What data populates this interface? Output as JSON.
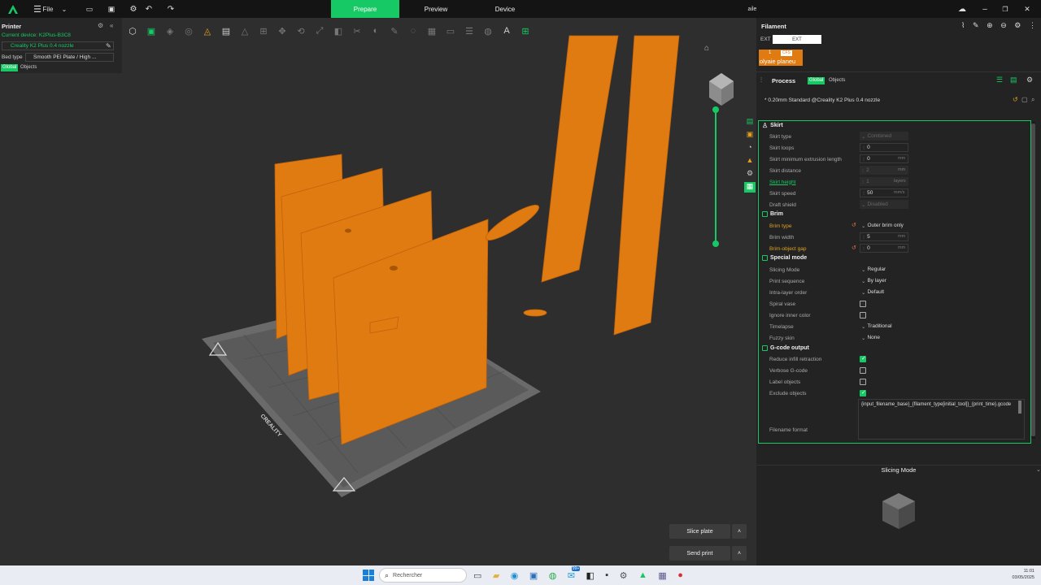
{
  "topbar": {
    "file_label": "File",
    "tabs": [
      "Prepare",
      "Preview",
      "Device"
    ],
    "window_title": "aile"
  },
  "printer": {
    "title": "Printer",
    "current_device": "Current device: K2Plus-B3C8",
    "profile": "Creality K2 Plus 0.4 nozzle",
    "bed_type_label": "Bed type",
    "bed_type_value": "Smooth PEI Plate / High ...",
    "scope_global": "Global",
    "scope_objects": "Objects"
  },
  "filament": {
    "title": "Filament",
    "ext_label": "EXT",
    "ext_value": "EXT",
    "slot_number": "1",
    "slot_tag": "CFS",
    "slot_name": "olyaie planeu"
  },
  "process": {
    "title": "Process",
    "scope_global": "Global",
    "scope_objects": "Objects",
    "preset": "* 0.20mm Standard @Creality K2 Plus 0.4 nozzle"
  },
  "sections": {
    "skirt": "Skirt",
    "brim": "Brim",
    "special": "Special mode",
    "gcode": "G-code output"
  },
  "settings": {
    "skirt_type": {
      "label": "Skirt type",
      "value": "Combined"
    },
    "skirt_loops": {
      "label": "Skirt loops",
      "value": "0"
    },
    "skirt_min_extrusion": {
      "label": "Skirt minimum extrusion length",
      "value": "0",
      "unit": "mm"
    },
    "skirt_distance": {
      "label": "Skirt distance",
      "value": "2",
      "unit": "mm"
    },
    "skirt_height": {
      "label": "Skirt height",
      "value": "1",
      "unit": "layers"
    },
    "skirt_speed": {
      "label": "Skirt speed",
      "value": "50",
      "unit": "mm/s"
    },
    "draft_shield": {
      "label": "Draft shield",
      "value": "Disabled"
    },
    "brim_type": {
      "label": "Brim type",
      "value": "Outer brim only"
    },
    "brim_width": {
      "label": "Brim width",
      "value": "5",
      "unit": "mm"
    },
    "brim_gap": {
      "label": "Brim-object gap",
      "value": "0",
      "unit": "mm"
    },
    "slicing_mode": {
      "label": "Slicing Mode",
      "value": "Regular"
    },
    "print_sequence": {
      "label": "Print sequence",
      "value": "By layer"
    },
    "intra_layer": {
      "label": "Intra-layer order",
      "value": "Default"
    },
    "spiral_vase": {
      "label": "Spiral vase",
      "checked": false
    },
    "ignore_inner": {
      "label": "Ignore inner color",
      "checked": false
    },
    "timelapse": {
      "label": "Timelapse",
      "value": "Traditional"
    },
    "fuzzy_skin": {
      "label": "Fuzzy skin",
      "value": "None"
    },
    "reduce_infill": {
      "label": "Reduce infill retraction",
      "checked": true
    },
    "verbose_gcode": {
      "label": "Verbose G-code",
      "checked": false
    },
    "label_objects": {
      "label": "Label objects",
      "checked": false
    },
    "exclude_objects": {
      "label": "Exclude objects",
      "checked": true
    },
    "filename_format": {
      "label": "Filename format",
      "value": "{input_filename_base}_{filament_type[initial_tool]}_{print_time}.gcode"
    }
  },
  "help_panel": {
    "title": "Slicing Mode"
  },
  "actions": {
    "slice": "Slice plate",
    "send": "Send print"
  },
  "taskbar": {
    "search_placeholder": "Rechercher",
    "time": "11:01",
    "date": "03/05/2025",
    "badge": "99+"
  },
  "colors": {
    "accent": "#17c964",
    "model": "#e07b12",
    "warning": "#e0a020"
  }
}
